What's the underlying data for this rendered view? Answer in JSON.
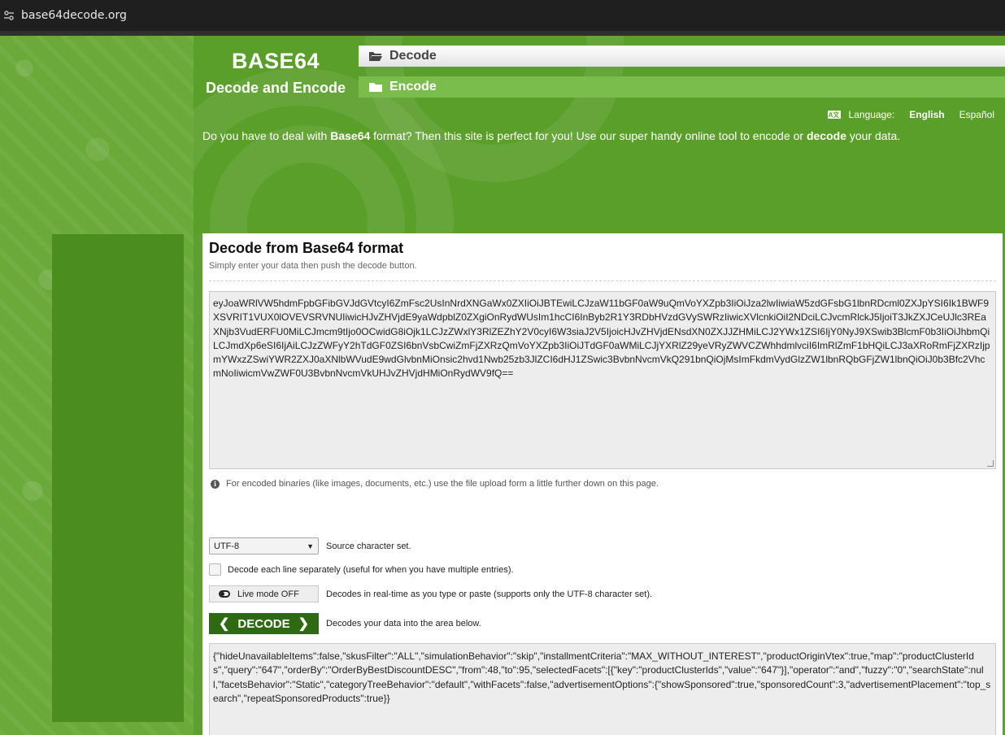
{
  "browser": {
    "url": "base64decode.org",
    "icon": "site-settings-icon"
  },
  "brand": {
    "title": "BASE64",
    "subtitle": "Decode and Encode"
  },
  "nav": {
    "decode_label": "Decode",
    "encode_label": "Encode",
    "icon": "folder-icon"
  },
  "language": {
    "label": "Language:",
    "active": "English",
    "other": "Español",
    "icon": "translate-icon"
  },
  "intro": {
    "part1": "Do you have to deal with ",
    "bold1": "Base64",
    "part2": " format? Then this site is perfect for you! Use our super handy online tool to encode or ",
    "bold2": "decode",
    "part3": " your data."
  },
  "main": {
    "title": "Decode from Base64 format",
    "subtitle": "Simply enter your data then push the decode button.",
    "input_value": "eyJoaWRlVW5hdmFpbGFibGVJdGVtcyI6ZmFsc2UsInNrdXNGaWx0ZXIiOiJBTEwiLCJzaW11bGF0aW9uQmVoYXZpb3IiOiJza2lwIiwiaW5zdGFsbG1lbnRDcml0ZXJpYSI6Ik1BWF9XSVRIT1VUX0lOVEVSRVNUIiwicHJvZHVjdE9yaWdpblZ0ZXgiOnRydWUsIm1hcCI6InByb2R1Y3RDbHVzdGVySWRzIiwicXVlcnkiOiI2NDciLCJvcmRlckJ5IjoiT3JkZXJCeUJlc3REaXNjb3VudERFU0MiLCJmcm9tIjo0OCwidG8iOjk1LCJzZWxlY3RlZEZhY2V0cyI6W3siaJ2V5IjoicHJvZHVjdENsdXN0ZXJJZHMiLCJ2YWx1ZSI6IjY0NyJ9XSwib3BlcmF0b3IiOiJhbmQiLCJmdXp6eSI6IjAiLCJzZWFyY2hTdGF0ZSI6bnVsbCwiZmFjZXRzQmVoYXZpb3IiOiJTdGF0aWMiLCJjYXRlZ29yeVRyZWVCZWhhdmlvciI6ImRlZmF1bHQiLCJ3aXRoRmFjZXRzIjpmYWxzZSwiYWR2ZXJ0aXNlbWVudE9wdGlvbnMiOnsic2hvd1Nwb25zb3JlZCI6dHJ1ZSwic3BvbnNvcmVkQ291bnQiOjMsImFkdmVydGlzZW1lbnRQbGFjZW1lbnQiOiJ0b3Bfc2VhcmNoIiwicmVwZWF0U3BvbnNvcmVkUHJvZHVjdHMiOnRydWV9fQ==",
    "note": "For encoded binaries (like images, documents, etc.) use the file upload form a little further down on this page.",
    "charset_value": "UTF-8",
    "charset_label": "Source character set.",
    "each_line_label": "Decode each line separately (useful for when you have multiple entries).",
    "live_mode_label": "Live mode OFF",
    "live_mode_desc": "Decodes in real-time as you type or paste (supports only the UTF-8 character set).",
    "decode_button": "DECODE",
    "decode_desc": "Decodes your data into the area below.",
    "output_value": "{\"hideUnavailableItems\":false,\"skusFilter\":\"ALL\",\"simulationBehavior\":\"skip\",\"installmentCriteria\":\"MAX_WITHOUT_INTEREST\",\"productOriginVtex\":true,\"map\":\"productClusterIds\",\"query\":\"647\",\"orderBy\":\"OrderByBestDiscountDESC\",\"from\":48,\"to\":95,\"selectedFacets\":[{\"key\":\"productClusterIds\",\"value\":\"647\"}],\"operator\":\"and\",\"fuzzy\":\"0\",\"searchState\":null,\"facetsBehavior\":\"Static\",\"categoryTreeBehavior\":\"default\",\"withFacets\":false,\"advertisementOptions\":{\"showSponsored\":true,\"sponsoredCount\":3,\"advertisementPlacement\":\"top_search\",\"repeatSponsoredProducts\":true}}"
  },
  "colors": {
    "brand_green": "#5b9f2b",
    "button_green": "#2e6a12",
    "tab_green": "#7bbd4c"
  }
}
